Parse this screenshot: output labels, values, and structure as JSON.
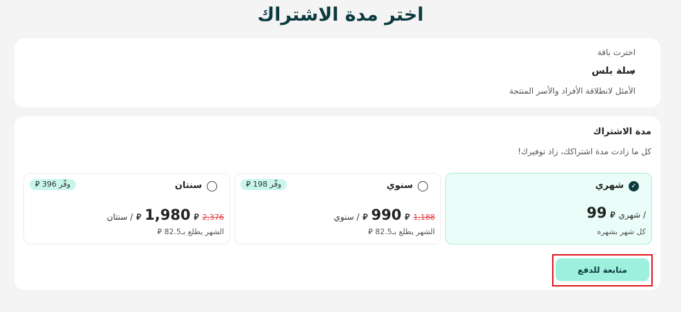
{
  "page": {
    "title": "اختر مدة الاشتراك"
  },
  "plan": {
    "label": "اخترت باقة",
    "name": "سلة بلس",
    "description": "الأمثل لانطلاقة الأفراد والأسر المنتجة",
    "arrow_icon": "arrow-right-icon"
  },
  "subscription": {
    "heading": "مدة الاشتراك",
    "subheading": "كل ما زادت مدة اشتراكك، زاد توفيرك!",
    "options": [
      {
        "name": "شهري",
        "selected": true,
        "price": "99",
        "currency": "⃁",
        "per": "/ شهري",
        "note": "كل شهر بشهره"
      },
      {
        "name": "سنوي",
        "selected": false,
        "price": "990",
        "currency": "⃁",
        "per": "/ سنوي",
        "old_price": "1,188",
        "save_prefix": "وفّر",
        "save_amount": "198",
        "note": "الشهر يطلع بـ82.5"
      },
      {
        "name": "سنتان",
        "selected": false,
        "price": "1,980",
        "currency": "⃁",
        "per": "/ سنتان",
        "old_price": "2,376",
        "save_prefix": "وفّر",
        "save_amount": "396",
        "note": "الشهر يطلع بـ82.5"
      }
    ]
  },
  "cta": {
    "label": "متابعة للدفع"
  },
  "colors": {
    "accent": "#9df0dd",
    "selected_bg": "#eafdf8",
    "title": "#0b3b40",
    "discount": "#e23b3b",
    "highlight_border": "#e0141c"
  }
}
